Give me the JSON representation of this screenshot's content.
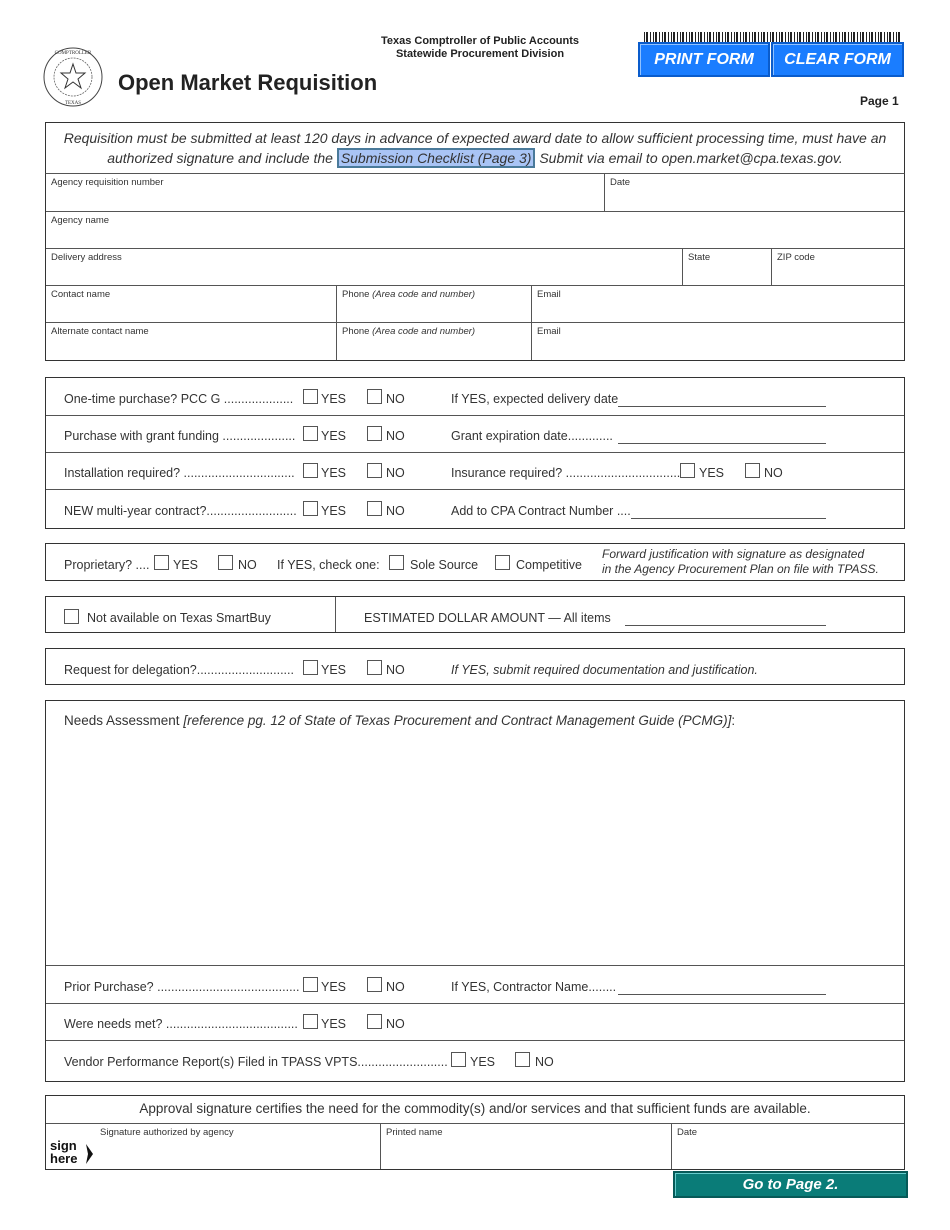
{
  "header": {
    "agency_line1": "Texas Comptroller of Public Accounts",
    "agency_line2": "Statewide Procurement Division",
    "title": "Open Market Requisition",
    "print_button": "PRINT FORM",
    "clear_button": "CLEAR FORM",
    "page_label": "Page 1",
    "seal_text_top": "OFFICE OF THE COMPTROLLER",
    "seal_text_bottom": "TEXAS"
  },
  "notice": {
    "part1": "Requisition must be submitted at least 120 days in advance of expected award date to allow sufficient processing time, must have an authorized signature and include the",
    "link": "Submission Checklist (Page 3)",
    "part2": "Submit via email to open.market@cpa.texas.gov."
  },
  "fields": {
    "agency_requisition_number": "Agency requisition number",
    "date": "Date",
    "agency_name": "Agency name",
    "delivery_address": "Delivery address",
    "state": "State",
    "zip": "ZIP code",
    "contact_name": "Contact name",
    "phone": "Phone",
    "phone_hint": "(Area code and number)",
    "email": "Email",
    "alt_contact_name": "Alternate contact name"
  },
  "options": {
    "yes": "YES",
    "no": "NO"
  },
  "questions": {
    "one_time": "One-time purchase?  PCC G ....................",
    "delivery_date": "If YES, expected delivery date",
    "grant": "Purchase with grant funding .....................",
    "grant_exp": "Grant expiration date.............",
    "installation": "Installation required?  ................................",
    "insurance": "Insurance required? .................................",
    "multi_year": "NEW multi-year contract?..........................",
    "cpa_contract": "Add to CPA Contract Number ....",
    "proprietary": "Proprietary? ....",
    "check_one": "If YES, check one:",
    "sole_source": "Sole Source",
    "competitive": "Competitive",
    "forward_just_1": "Forward justification with signature as designated",
    "forward_just_2": "in the Agency Procurement Plan on file with TPASS.",
    "not_smartbuy": "Not available on Texas SmartBuy",
    "est_dollar": "ESTIMATED DOLLAR AMOUNT — All items",
    "delegation": "Request for delegation?............................",
    "delegation_note": "If YES, submit required documentation and justification."
  },
  "needs": {
    "label": "Needs Assessment",
    "reference": "[reference pg. 12 of State of Texas Procurement and Contract Management Guide (PCMG)]",
    "colon": ":",
    "prior": "Prior Purchase? .........................................",
    "contractor": "If YES, Contractor Name........",
    "needs_met": "Were needs met? ......................................",
    "vendor_perf": "Vendor Performance Report(s) Filed in TPASS VPTS.........................."
  },
  "approval": {
    "statement": "Approval signature certifies the need for the commodity(s) and/or services and that sufficient funds are available.",
    "signature": "Signature authorized by agency",
    "sign": "sign",
    "here": "here",
    "printed_name": "Printed name",
    "date": "Date"
  },
  "footer": {
    "go_button": "Go to Page 2."
  }
}
